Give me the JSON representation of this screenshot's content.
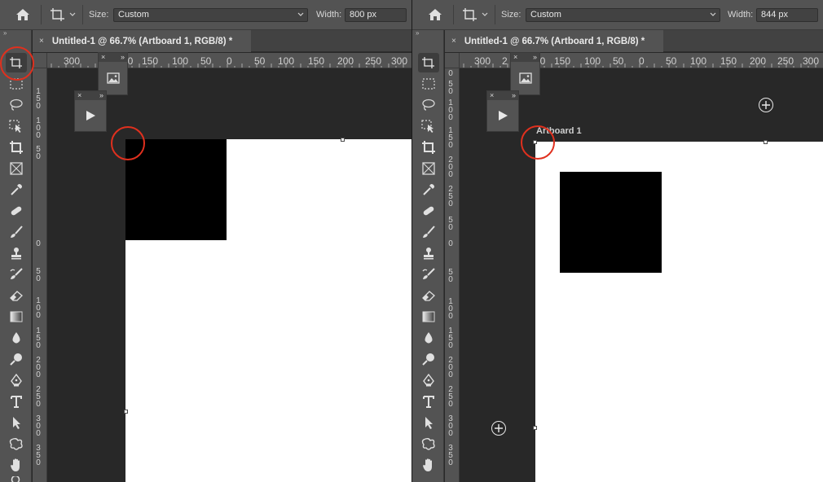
{
  "panes": [
    {
      "options": {
        "size_label": "Size:",
        "size_value": "Custom",
        "width_label": "Width:",
        "width_value": "800 px"
      },
      "tab": {
        "close": "×",
        "title": "Untitled-1 @ 66.7% (Artboard 1, RGB/8) *"
      },
      "ruler": {
        "h_labels": [
          "300",
          "00",
          "150",
          "100",
          "50",
          "0",
          "50",
          "100",
          "150",
          "200",
          "250",
          "300"
        ],
        "v_labels": [
          "1\n5\n0",
          "1\n0\n0",
          "5\n0",
          "0",
          "5\n0",
          "1\n0\n0",
          "1\n5\n0",
          "2\n0\n0",
          "2\n5\n0",
          "3\n0\n0",
          "3\n5\n0"
        ]
      },
      "panels": {
        "collapse": "»",
        "close": "×"
      }
    },
    {
      "options": {
        "size_label": "Size:",
        "size_value": "Custom",
        "width_label": "Width:",
        "width_value": "844 px"
      },
      "tab": {
        "close": "×",
        "title": "Untitled-1 @ 66.7% (Artboard 1, RGB/8) *"
      },
      "ruler": {
        "h_labels": [
          "300",
          "2",
          "00",
          "150",
          "100",
          "50",
          "0",
          "50",
          "100",
          "150",
          "200",
          "250",
          "300"
        ],
        "v_labels": [
          "0",
          "5\n0",
          "1\n0\n0",
          "1\n5\n0",
          "2\n0\n0",
          "2\n5\n0",
          "5\n0",
          "0",
          "5\n0",
          "1\n0\n0",
          "1\n5\n0",
          "2\n0\n0",
          "2\n5\n0",
          "3\n0\n0",
          "3\n5\n0"
        ]
      },
      "artboard_label": "Artboard 1",
      "panels": {
        "collapse": "»",
        "close": "×"
      }
    }
  ],
  "icons": {
    "home": "home-icon",
    "artboard_tool": "artboard-tool-icon",
    "play": "play-icon",
    "image": "image-icon",
    "add_artboard": "plus-circle-icon"
  },
  "colors": {
    "ui_panel": "#535353",
    "canvas": "#282828",
    "highlight": "#e0301e"
  }
}
